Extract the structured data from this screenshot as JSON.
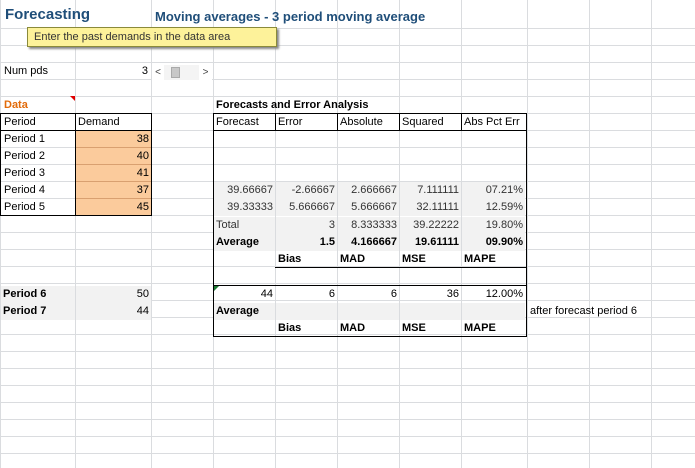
{
  "title": "Forecasting",
  "subtitle": "Moving averages -  3 period moving average",
  "note": "Enter the past demands in the data area",
  "num_pds": {
    "label": "Num pds",
    "value": "3"
  },
  "data_section": {
    "label": "Data",
    "headers": [
      "Period",
      "Demand"
    ],
    "rows": [
      {
        "period": "Period 1",
        "demand": "38"
      },
      {
        "period": "Period 2",
        "demand": "40"
      },
      {
        "period": "Period 3",
        "demand": "41"
      },
      {
        "period": "Period 4",
        "demand": "37"
      },
      {
        "period": "Period 5",
        "demand": "45"
      }
    ],
    "future": [
      {
        "period": "Period 6",
        "demand": "50"
      },
      {
        "period": "Period 7",
        "demand": "44"
      }
    ]
  },
  "analysis": {
    "label": "Forecasts and Error Analysis",
    "headers": [
      "Forecast",
      "Error",
      "Absolute",
      "Squared",
      "Abs Pct Err"
    ],
    "rows": [
      [
        "39.66667",
        "-2.66667",
        "2.666667",
        "7.111111",
        "07.21%"
      ],
      [
        "39.33333",
        "5.666667",
        "5.666667",
        "32.11111",
        "12.59%"
      ]
    ],
    "total": {
      "label": "Total",
      "values": [
        "3",
        "8.333333",
        "39.22222",
        "19.80%"
      ]
    },
    "average": {
      "label": "Average",
      "values": [
        "1.5",
        "4.166667",
        "19.61111",
        "09.90%"
      ]
    },
    "metric_labels": [
      "Bias",
      "MAD",
      "MSE",
      "MAPE"
    ],
    "period6": [
      "44",
      "6",
      "6",
      "36",
      "12.00%"
    ],
    "period6_average_label": "Average",
    "period6_metric_labels": [
      "Bias",
      "MAD",
      "MSE",
      "MAPE"
    ],
    "after_note": "after forecast period 6"
  },
  "scrollbar": {
    "left": "<",
    "right": ">"
  }
}
